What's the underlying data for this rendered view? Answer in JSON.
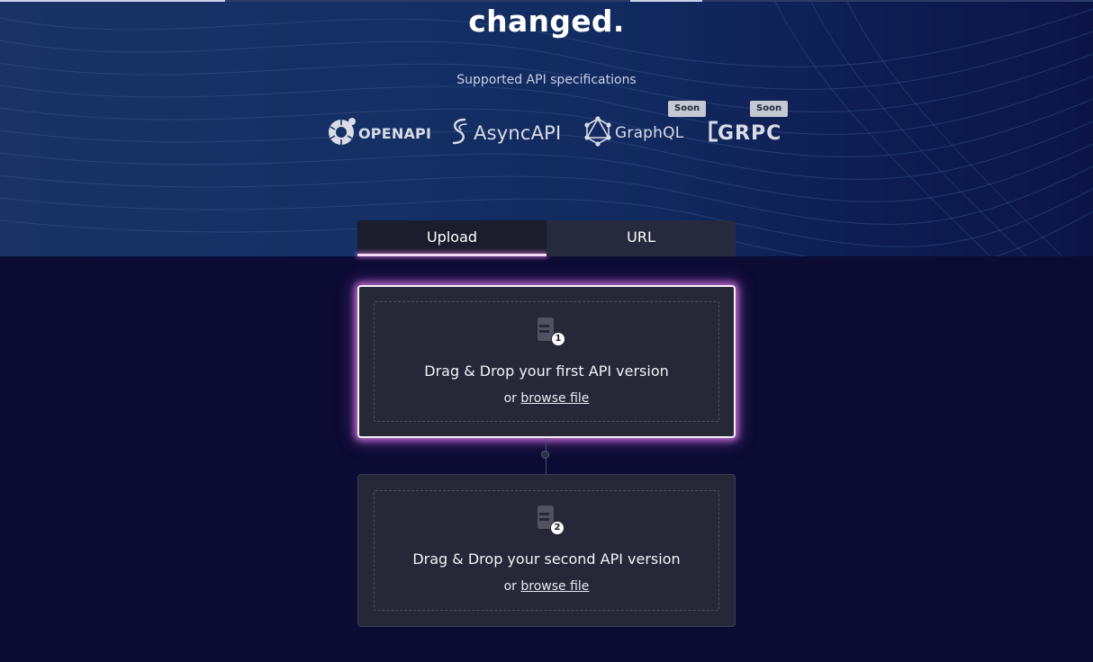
{
  "hero": {
    "headline": "changed.",
    "specs_title": "Supported API specifications",
    "specs": [
      {
        "name": "OPENAPI",
        "icon": "openapi-logo-icon",
        "soon": ""
      },
      {
        "name": "AsyncAPI",
        "icon": "asyncapi-logo-icon",
        "soon": ""
      },
      {
        "name": "GraphQL",
        "icon": "graphql-logo-icon",
        "soon": "Soon"
      },
      {
        "name": "GRPC",
        "icon": "grpc-logo-icon",
        "soon": "Soon"
      }
    ]
  },
  "tabs": [
    {
      "label": "Upload",
      "active": true
    },
    {
      "label": "URL",
      "active": false
    }
  ],
  "dropzones": [
    {
      "step": "1",
      "title": "Drag & Drop your first API version",
      "prefix": "or",
      "link": "browse file",
      "icon": "file-icon"
    },
    {
      "step": "2",
      "title": "Drag & Drop your second API version",
      "prefix": "or",
      "link": "browse file",
      "icon": "file-icon"
    }
  ],
  "colors": {
    "background": "#0c0b33",
    "hero": "#143064",
    "card": "#262838",
    "accent_glow": "#d67ae6"
  }
}
